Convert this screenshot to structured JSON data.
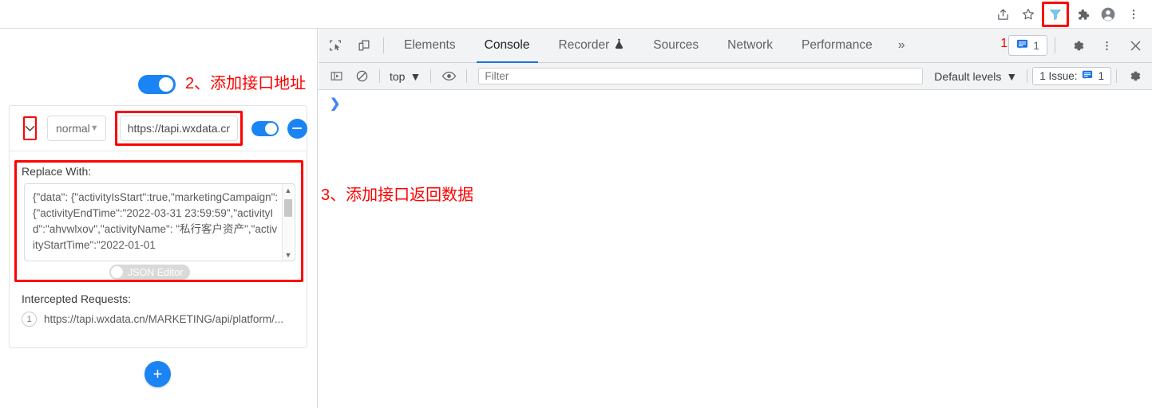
{
  "browser": {
    "actions": [
      {
        "name": "share-icon",
        "label": "Share"
      },
      {
        "name": "bookmark-star-icon",
        "label": "Bookmark this tab"
      },
      {
        "name": "filter-extension-icon",
        "label": "Request Interceptor"
      },
      {
        "name": "extensions-puzzle-icon",
        "label": "Extensions"
      },
      {
        "name": "profile-avatar-icon",
        "label": "Profile"
      },
      {
        "name": "chrome-menu-icon",
        "label": "Customize and control Google Chrome"
      }
    ]
  },
  "annotations": {
    "step1": "1",
    "step2": "2、添加接口地址",
    "step3": "3、添加接口返回数据"
  },
  "extension_panel": {
    "global_toggle_on": true,
    "rule": {
      "collapse_caret": "⌄",
      "method": "normal",
      "method_caret": "⌄",
      "url_value": "https://tapi.wxdata.cn",
      "enabled_toggle_on": true,
      "remove_label": "−"
    },
    "replace_with": {
      "label": "Replace With:",
      "json_body": "{\"data\": {\"activityIsStart\":true,\"marketingCampaign\": {\"activityEndTime\":\"2022-03-31 23:59:59\",\"activityId\":\"ahvwlxov\",\"activityName\": \"私行客户资产\",\"activityStartTime\":\"2022-01-01",
      "json_editor_label": "JSON Editor",
      "json_editor_on": false
    },
    "intercepted": {
      "label": "Intercepted Requests:",
      "count": "1",
      "url": "https://tapi.wxdata.cn/MARKETING/api/platform/..."
    },
    "add_rule_label": "+"
  },
  "devtools": {
    "tabs": [
      {
        "label": "Elements",
        "active": false,
        "icon": ""
      },
      {
        "label": "Console",
        "active": true,
        "icon": ""
      },
      {
        "label": "Recorder",
        "active": false,
        "icon": "flask"
      },
      {
        "label": "Sources",
        "active": false,
        "icon": ""
      },
      {
        "label": "Network",
        "active": false,
        "icon": ""
      },
      {
        "label": "Performance",
        "active": false,
        "icon": ""
      }
    ],
    "more_tabs": "»",
    "issue_chip_count": "1",
    "toolbar_icons": {
      "inspect": "inspect-element-icon",
      "device": "device-toolbar-icon",
      "settings": "settings-gear-icon",
      "more": "more-vertical-icon",
      "close": "close-icon"
    },
    "filterbar": {
      "sidebar_toggle": "console-sidebar-icon",
      "clear": "clear-console-icon",
      "context": "top",
      "context_caret": "▼",
      "eye": "live-expression-icon",
      "filter_placeholder": "Filter",
      "filter_value": "",
      "levels": "Default levels",
      "levels_caret": "▼",
      "issues_text": "1 Issue:",
      "issues_count": "1",
      "settings": "settings-gear-icon"
    },
    "console_prompt": "❯"
  },
  "colors": {
    "accent_blue": "#1a84f5",
    "devtools_blue": "#1a73e8",
    "annotation_red": "#ff0000",
    "toolbar_bg": "#f1f3f4"
  }
}
